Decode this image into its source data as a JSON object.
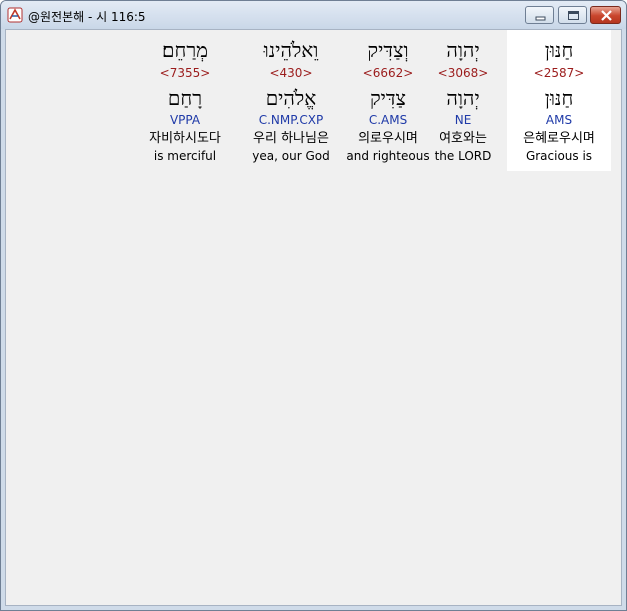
{
  "window": {
    "title": "@원전본해 - 시 116:5",
    "controls": [
      "minimize",
      "maximize",
      "close"
    ]
  },
  "words": [
    {
      "hebrew": "מְרַחֵם׃",
      "strong": "<7355>",
      "lemma": "רָחַם",
      "parse": "VPPA",
      "korean": "자비하시도다",
      "english": "is merciful",
      "selected": false
    },
    {
      "hebrew": "וֵאלֹהֵינוּ",
      "strong": "<430>",
      "lemma": "אֱלֹהִים",
      "parse": "C.NMP.CXP",
      "korean": "우리 하나님은",
      "english": "yea, our God",
      "selected": false
    },
    {
      "hebrew": "וְצַדִּיק",
      "strong": "<6662>",
      "lemma": "צַדִּיק",
      "parse": "C.AMS",
      "korean": "의로우시며",
      "english": "and righteous",
      "selected": false
    },
    {
      "hebrew": "יְהוָה",
      "strong": "<3068>",
      "lemma": "יְהוָה",
      "parse": "NE",
      "korean": "여호와는",
      "english": "the LORD",
      "selected": false
    },
    {
      "hebrew": "חַנּוּן",
      "strong": "<2587>",
      "lemma": "חַנּוּן",
      "parse": "AMS",
      "korean": "은혜로우시며",
      "english": "Gracious is",
      "selected": true
    }
  ],
  "colors": {
    "strong": "#9b1c1c",
    "parse": "#1f3aa8",
    "selected_bg": "#ffffff",
    "client_bg": "#f0f0f0"
  }
}
